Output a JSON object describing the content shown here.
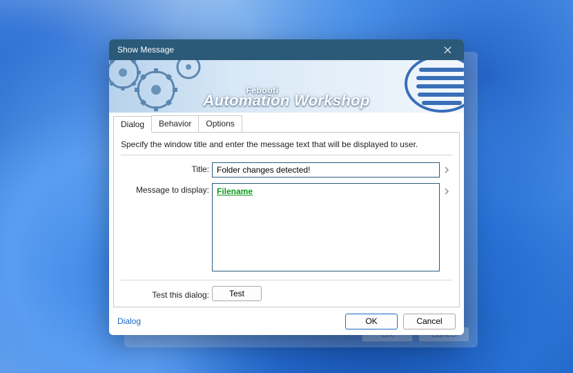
{
  "window": {
    "title": "Show Message",
    "brand": "Febooti",
    "product": "Automation Workshop"
  },
  "tabs": {
    "dialog": "Dialog",
    "behavior": "Behavior",
    "options": "Options",
    "active": "Dialog"
  },
  "panel": {
    "instruction": "Specify the window title and enter the message text that will be displayed to user.",
    "title_label": "Title:",
    "title_value": "Folder changes detected!",
    "message_label": "Message to display:",
    "message_variable": "Filename",
    "test_label": "Test this dialog:",
    "test_button": "Test"
  },
  "footer": {
    "help_link": "Dialog",
    "ok": "OK",
    "cancel": "Cancel"
  },
  "behind": {
    "ok": "OK",
    "cancel": "Cancel"
  }
}
